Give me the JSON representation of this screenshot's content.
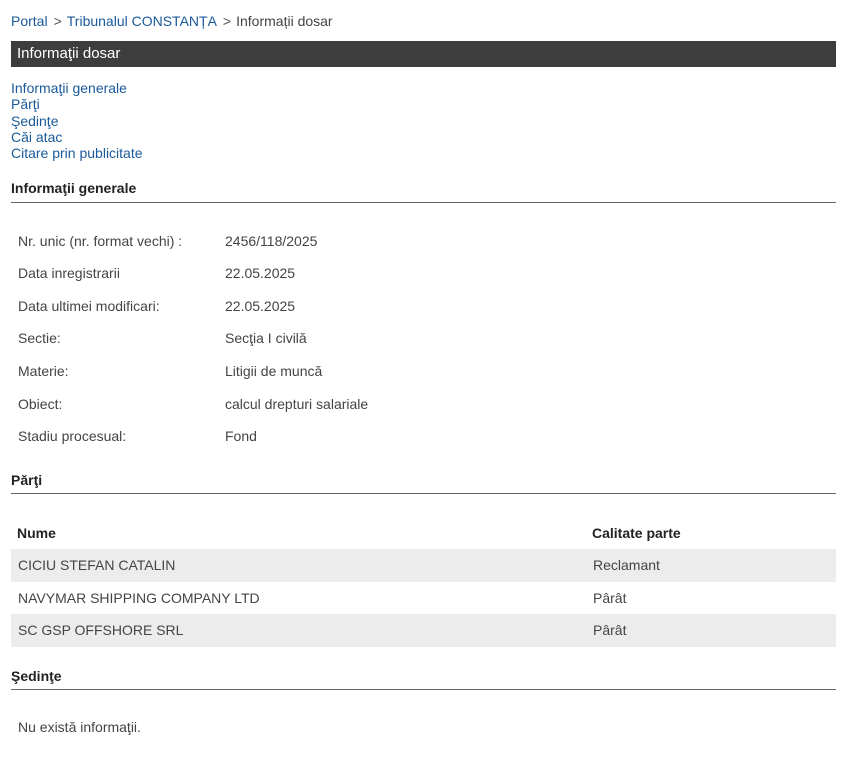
{
  "breadcrumb": {
    "items": [
      "Portal",
      "Tribunalul CONSTANȚA",
      "Informații dosar"
    ],
    "separator": ">"
  },
  "title": "Informaţii dosar",
  "anchors": [
    "Informaţii generale",
    "Părţi",
    "Şedinţe",
    "Căi atac",
    "Citare prin publicitate"
  ],
  "general": {
    "heading": "Informaţii generale",
    "rows": [
      {
        "label": "Nr. unic (nr. format vechi) :",
        "value": "2456/118/2025"
      },
      {
        "label": "Data inregistrarii",
        "value": "22.05.2025"
      },
      {
        "label": "Data ultimei modificari:",
        "value": "22.05.2025"
      },
      {
        "label": "Sectie:",
        "value": "Secţia I civilă"
      },
      {
        "label": "Materie:",
        "value": "Litigii de muncă"
      },
      {
        "label": "Obiect:",
        "value": "calcul drepturi salariale"
      },
      {
        "label": "Stadiu procesual:",
        "value": "Fond"
      }
    ]
  },
  "parti": {
    "heading": "Părţi",
    "columns": [
      "Nume",
      "Calitate parte"
    ],
    "rows": [
      [
        "CICIU STEFAN CATALIN",
        "Reclamant"
      ],
      [
        "NAVYMAR SHIPPING COMPANY LTD",
        "Pârât"
      ],
      [
        "SC GSP OFFSHORE SRL",
        "Pârât"
      ]
    ]
  },
  "sedinte": {
    "heading": "Şedinţe",
    "empty_text": "Nu există informaţii."
  },
  "colors": {
    "link": "#1a5a9a",
    "titlebar_bg": "#3d3d3d",
    "row_stripe": "#ececec"
  }
}
